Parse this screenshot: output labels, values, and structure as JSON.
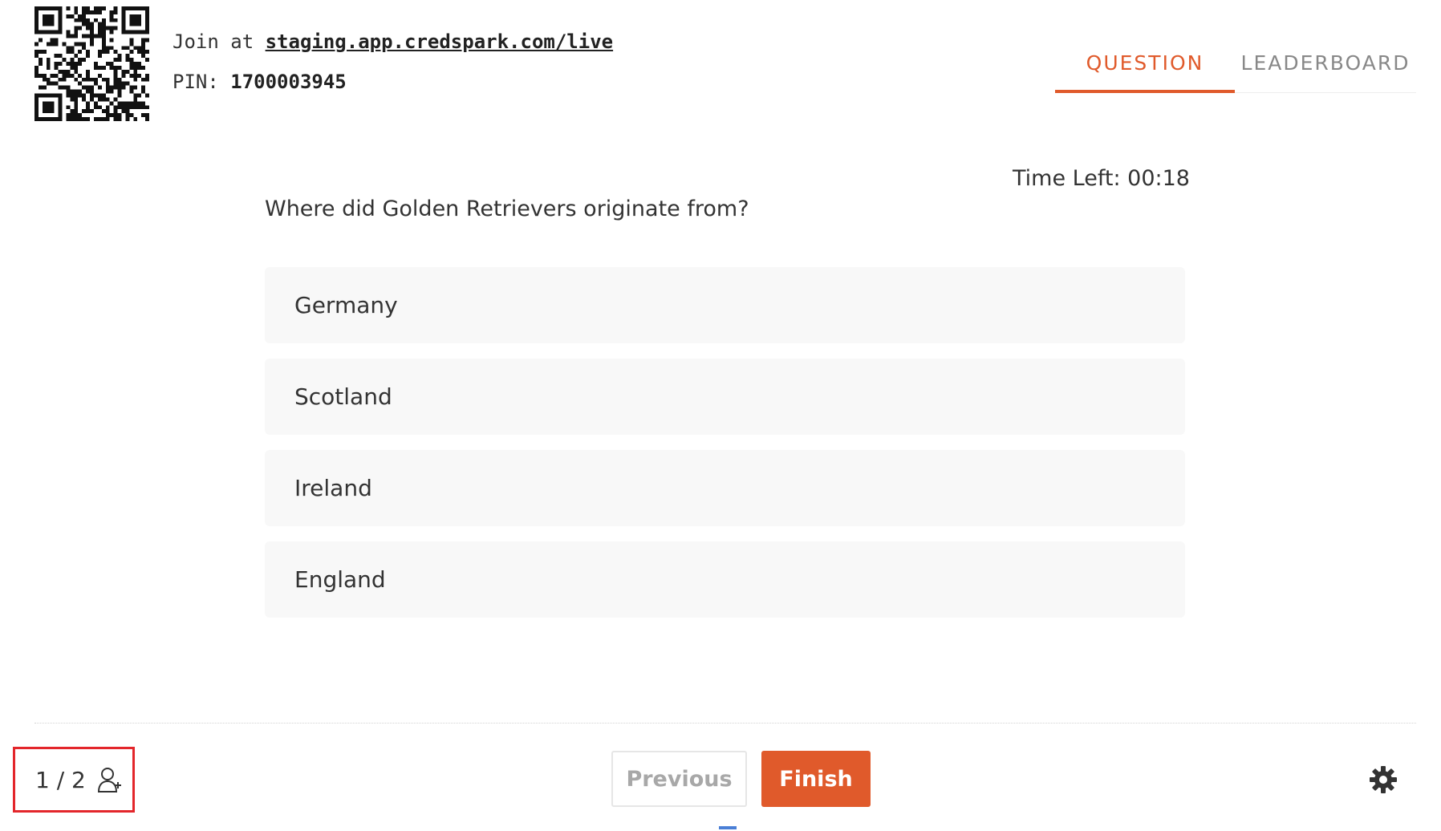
{
  "header": {
    "join_prefix": "Join at",
    "join_url": "staging.app.credspark.com/live",
    "pin_label": "PIN:",
    "pin_value": "1700003945",
    "qr_icon": "qr-code-icon"
  },
  "tabs": [
    {
      "label": "QUESTION",
      "active": true
    },
    {
      "label": "LEADERBOARD",
      "active": false
    }
  ],
  "timer": {
    "label": "Time Left: 00:18"
  },
  "question": {
    "text": "Where did Golden Retrievers originate from?",
    "choices": [
      "Germany",
      "Scotland",
      "Ireland",
      "England"
    ]
  },
  "footer": {
    "counter": "1 / 2",
    "add_user_icon": "add-user-icon",
    "previous_label": "Previous",
    "finish_label": "Finish",
    "settings_icon": "gear-icon"
  },
  "colors": {
    "accent": "#e05a2b",
    "highlight_box": "#e3262b"
  }
}
